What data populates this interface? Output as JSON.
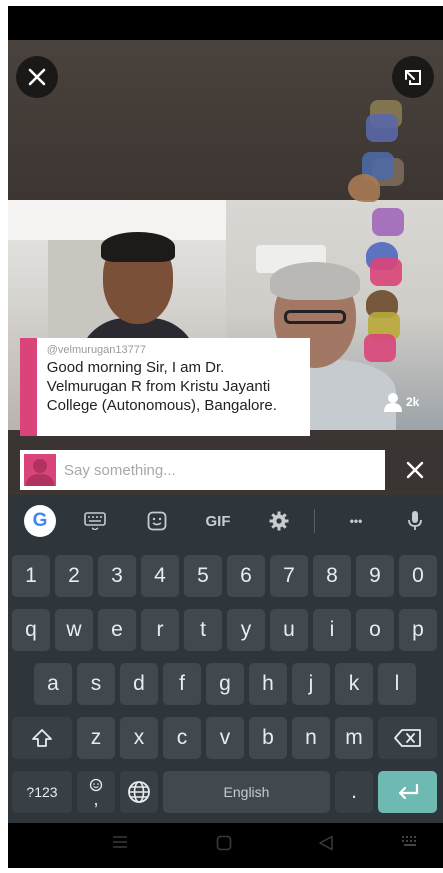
{
  "app": {
    "close_icon": "close-icon",
    "share_icon": "share-icon",
    "viewer_count": "2k"
  },
  "comment": {
    "username": "@velmurugan13777",
    "text": "Good morning Sir, I am Dr. Velmurugan R from Kristu Jayanti College (Autonomous), Bangalore."
  },
  "input": {
    "placeholder": "Say something...",
    "close_icon": "close-icon"
  },
  "keyboard": {
    "toolbar": {
      "google": "G",
      "gif": "GIF",
      "more": "•••"
    },
    "number_row": [
      "1",
      "2",
      "3",
      "4",
      "5",
      "6",
      "7",
      "8",
      "9",
      "0"
    ],
    "row1": [
      "q",
      "w",
      "e",
      "r",
      "t",
      "y",
      "u",
      "i",
      "o",
      "p"
    ],
    "row2": [
      "a",
      "s",
      "d",
      "f",
      "g",
      "h",
      "j",
      "k",
      "l"
    ],
    "row3": [
      "z",
      "x",
      "c",
      "v",
      "b",
      "n",
      "m"
    ],
    "bottom": {
      "symbols": "?123",
      "emoji_comma": ",",
      "space": "English",
      "period": "."
    }
  }
}
